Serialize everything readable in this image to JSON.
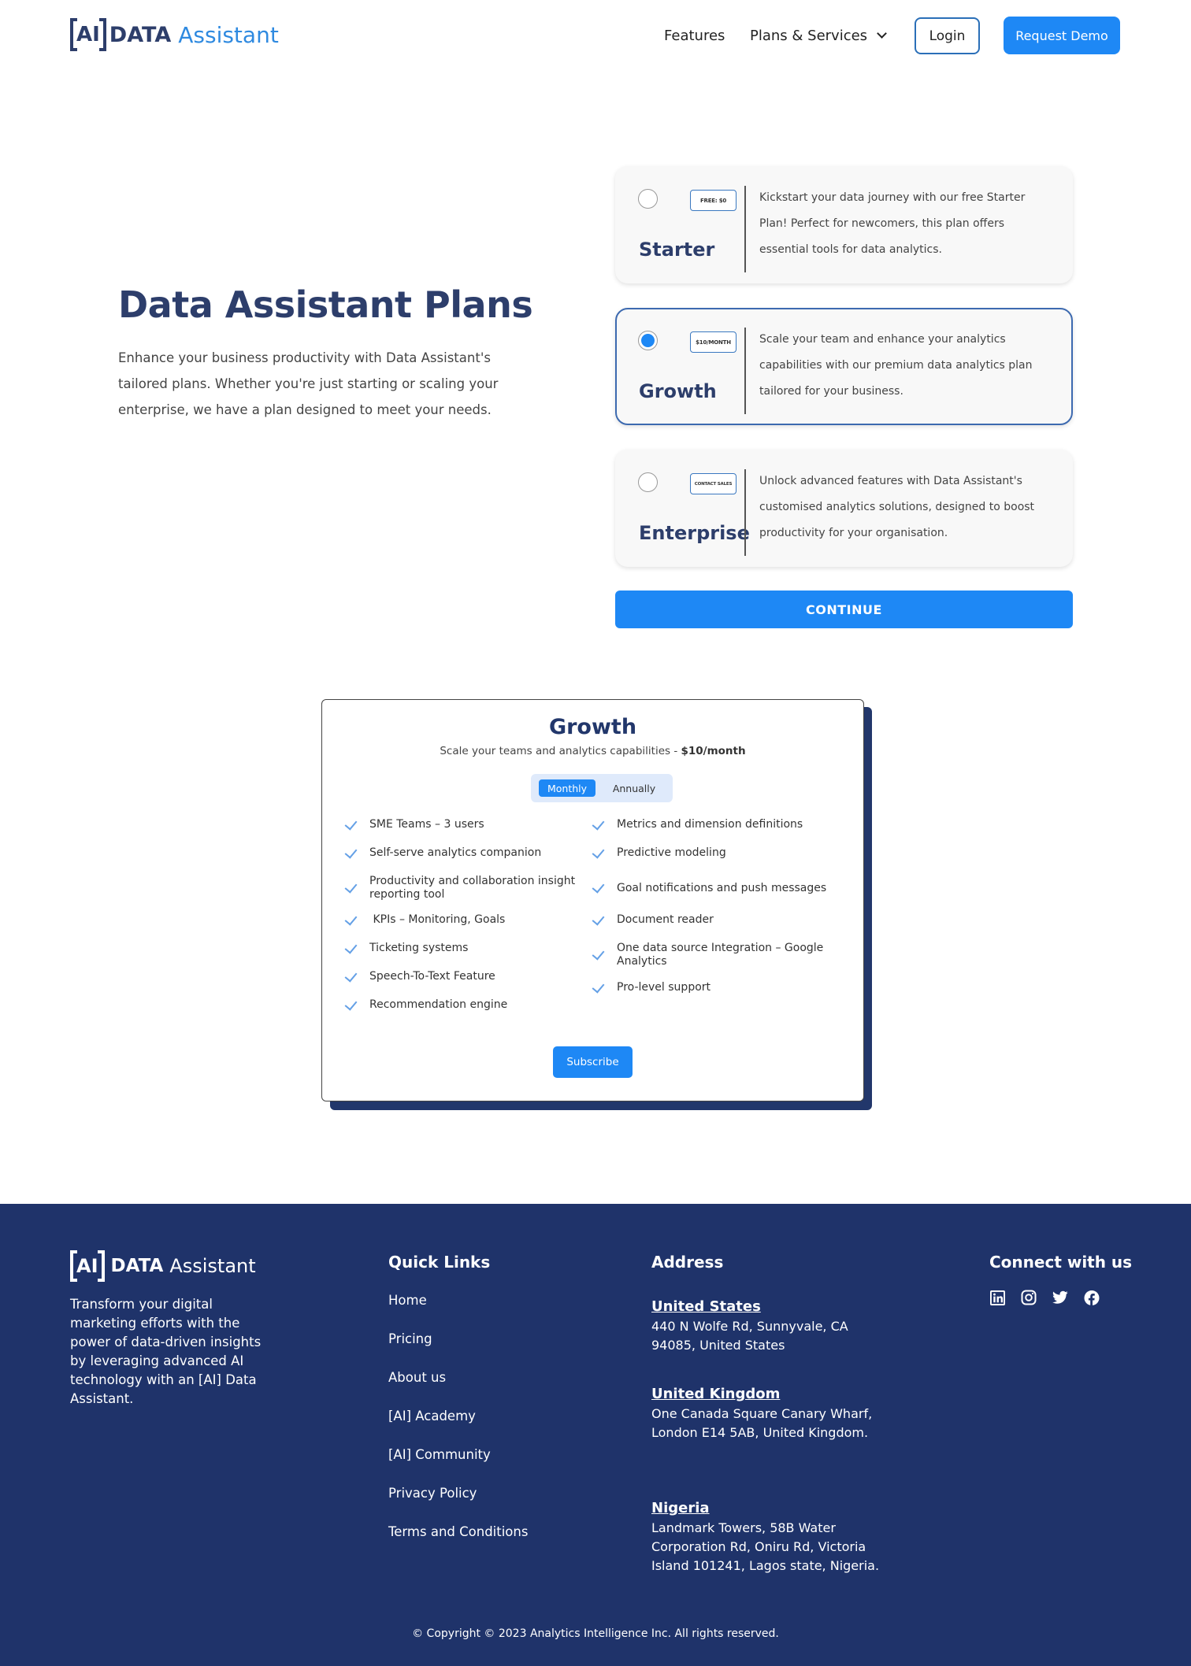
{
  "header": {
    "logo": {
      "bracket_text": "AI",
      "data_text": "DATA",
      "assistant_text": "Assistant"
    },
    "nav": {
      "features": "Features",
      "plans_services": "Plans & Services"
    },
    "login_label": "Login",
    "request_demo_label": "Request Demo"
  },
  "hero": {
    "title": "Data Assistant Plans",
    "description": "Enhance your business productivity with Data Assistant's tailored plans. Whether you're just starting or scaling your enterprise, we have a plan designed to meet your needs."
  },
  "plans": [
    {
      "name": "Starter",
      "badge": "FREE: $0",
      "selected": false,
      "description": "Kickstart your data journey with our free Starter Plan! Perfect for newcomers, this plan offers essential tools for data analytics."
    },
    {
      "name": "Growth",
      "badge": "$10/MONTH",
      "selected": true,
      "description": "Scale your team and enhance your analytics capabilities with our premium data analytics plan tailored for your business."
    },
    {
      "name": "Enterprise",
      "badge": "CONTACT SALES",
      "selected": false,
      "description": "Unlock advanced features with Data Assistant's customised analytics solutions, designed to boost productivity for your organisation."
    }
  ],
  "continue_label": "CONTINUE",
  "detail": {
    "title": "Growth",
    "subtitle": "Scale your teams and analytics capabilities - ",
    "price": "$10/month",
    "billing": {
      "monthly": "Monthly",
      "annually": "Annually",
      "selected": "Monthly"
    },
    "features_left": [
      "SME Teams – 3 users",
      "Self-serve analytics companion",
      "Productivity and collaboration insight reporting tool",
      " KPIs – Monitoring, Goals",
      "Ticketing systems",
      "Speech-To-Text Feature",
      "Recommendation engine"
    ],
    "features_right": [
      "Metrics and dimension definitions",
      "Predictive modeling",
      "Goal notifications and push messages",
      "Document reader",
      "One data source Integration – Google Analytics",
      "Pro-level support"
    ],
    "subscribe_label": "Subscribe"
  },
  "footer": {
    "logo": {
      "bracket_text": "AI",
      "data_text": "DATA",
      "assistant_text": "Assistant"
    },
    "tagline": "Transform your digital marketing efforts with the power of data-driven insights by leveraging advanced AI technology with an [AI] Data Assistant.",
    "quick_links_heading": "Quick Links",
    "quick_links": [
      "Home",
      "Pricing",
      "About us",
      "[AI] Academy",
      "[AI] Community",
      "Privacy Policy",
      "Terms and Conditions"
    ],
    "address_heading": "Address",
    "addresses": [
      {
        "country": "United States ",
        "text": "440 N Wolfe Rd, Sunnyvale, CA 94085, United States"
      },
      {
        "country": "United Kingdom ",
        "text": "One Canada Square Canary Wharf, London E14 5AB, United Kingdom."
      },
      {
        "country": "Nigeria",
        "text": "Landmark Towers, 58B Water Corporation Rd, Oniru Rd, Victoria Island 101241, Lagos state, Nigeria."
      }
    ],
    "connect_heading": "Connect with us",
    "socials": [
      "linkedin",
      "instagram",
      "twitter",
      "facebook"
    ],
    "copyright": "© Copyright © 2023 Analytics Intelligence Inc. All rights reserved."
  },
  "colors": {
    "brand_navy": "#2d3e6b",
    "accent_blue": "#1e88f5",
    "footer_bg": "#1f336a",
    "logo_assistant": "#2f8ae0"
  }
}
